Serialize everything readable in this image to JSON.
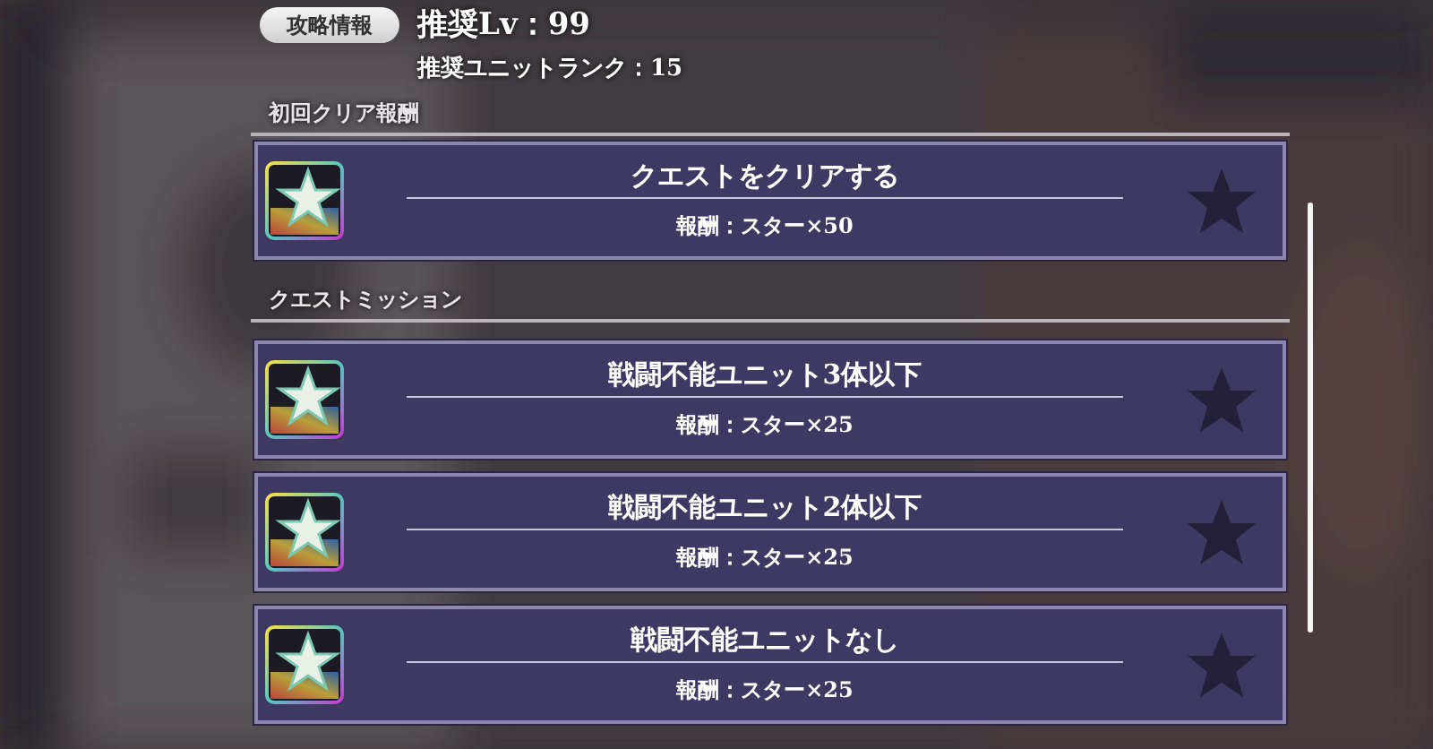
{
  "header": {
    "tag": "攻略情報",
    "recommended_level": "推奨Lv：99",
    "recommended_rank": "推奨ユニットランク：15"
  },
  "sections": [
    {
      "title": "初回クリア報酬",
      "quests": [
        {
          "title": "クエストをクリアする",
          "reward": "報酬：スター×50",
          "achieved": false
        }
      ]
    },
    {
      "title": "クエストミッション",
      "quests": [
        {
          "title": "戦闘不能ユニット3体以下",
          "reward": "報酬：スター×25",
          "achieved": false
        },
        {
          "title": "戦闘不能ユニット2体以下",
          "reward": "報酬：スター×25",
          "achieved": false
        },
        {
          "title": "戦闘不能ユニットなし",
          "reward": "報酬：スター×25",
          "achieved": false
        }
      ]
    }
  ]
}
